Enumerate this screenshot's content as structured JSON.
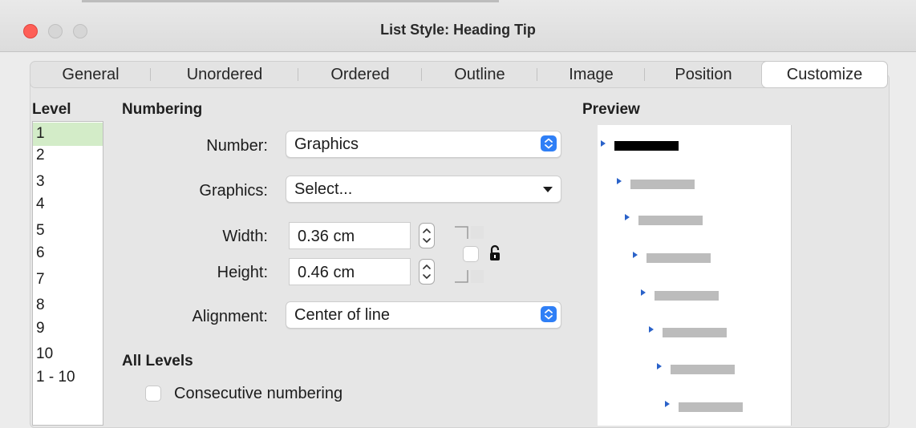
{
  "window": {
    "title": "List Style: Heading Tip"
  },
  "tabs": [
    {
      "label": "General"
    },
    {
      "label": "Unordered"
    },
    {
      "label": "Ordered"
    },
    {
      "label": "Outline"
    },
    {
      "label": "Image"
    },
    {
      "label": "Position"
    },
    {
      "label": "Customize",
      "active": true
    }
  ],
  "level": {
    "heading": "Level",
    "items": [
      "1",
      "2",
      "3",
      "4",
      "5",
      "6",
      "7",
      "8",
      "9",
      "10",
      "1 - 10"
    ],
    "selected": "1"
  },
  "numbering": {
    "heading": "Numbering",
    "number_label": "Number:",
    "number_value": "Graphics",
    "graphics_label": "Graphics:",
    "graphics_value": "Select...",
    "width_label": "Width:",
    "width_value": "0.36 cm",
    "height_label": "Height:",
    "height_value": "0.46 cm",
    "keep_ratio_checked": false,
    "alignment_label": "Alignment:",
    "alignment_value": "Center of line"
  },
  "all_levels": {
    "heading": "All Levels",
    "consecutive_label": "Consecutive numbering",
    "consecutive_checked": false
  },
  "preview": {
    "heading": "Preview",
    "bullet_color": "#2a62c9",
    "levels": [
      {
        "level": 1,
        "active": true
      },
      {
        "level": 2,
        "active": false
      },
      {
        "level": 3,
        "active": false
      },
      {
        "level": 4,
        "active": false
      },
      {
        "level": 5,
        "active": false
      },
      {
        "level": 6,
        "active": false
      },
      {
        "level": 7,
        "active": false
      },
      {
        "level": 8,
        "active": false
      }
    ]
  },
  "colors": {
    "close_button": "#fe5f57",
    "selection_green": "#d3ecc8",
    "accent_blue": "#2f7ff6",
    "preview_active_bar": "#000000",
    "preview_inactive_bar": "#bcbcbc"
  }
}
